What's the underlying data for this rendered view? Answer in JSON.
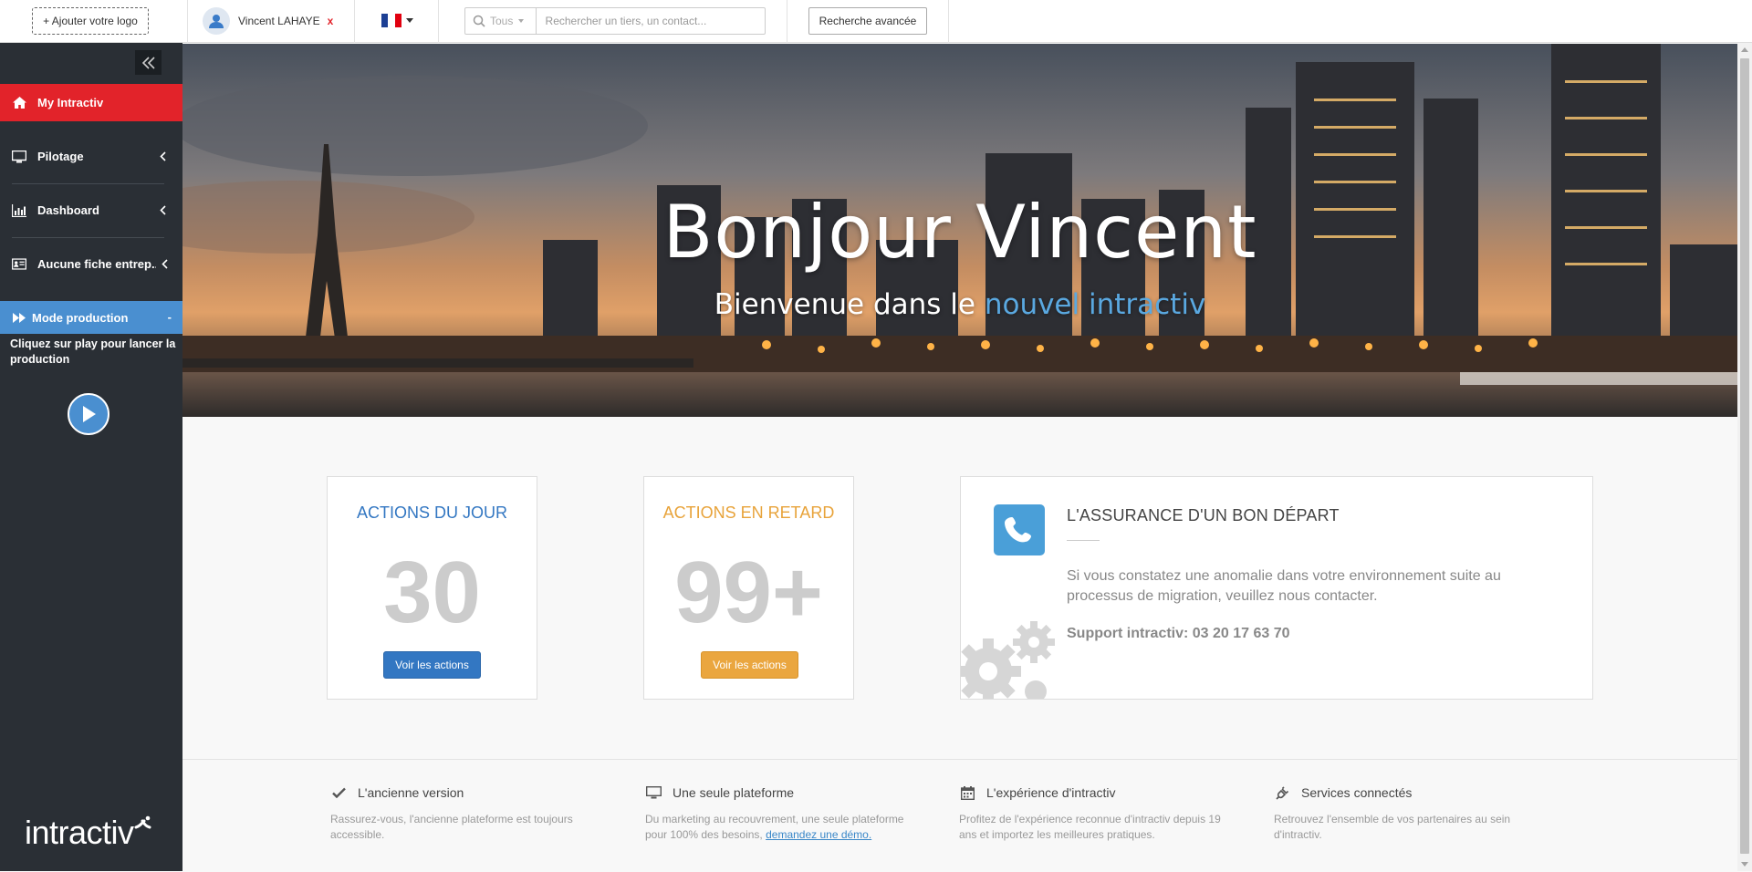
{
  "topbar": {
    "add_logo_label": "+ Ajouter votre logo",
    "user_name": "Vincent LAHAYE",
    "user_close": "x",
    "language_flag": "fr",
    "search_scope": "Tous",
    "search_placeholder": "Rechercher un tiers, un contact...",
    "advanced_search_label": "Recherche avancée"
  },
  "sidebar": {
    "items": [
      {
        "label": "My Intractiv",
        "icon": "home-icon",
        "active": true
      },
      {
        "label": "Pilotage",
        "icon": "monitor-icon"
      },
      {
        "label": "Dashboard",
        "icon": "bar-chart-icon"
      },
      {
        "label": "Aucune fiche entrep..",
        "icon": "id-card-icon"
      }
    ],
    "production": {
      "label": "Mode production",
      "toggle": "-",
      "description": "Cliquez sur play pour lancer la production"
    },
    "brand": "intractiv"
  },
  "hero": {
    "title": "Bonjour Vincent",
    "subtitle_prefix": "Bienvenue dans le",
    "subtitle_highlight": "nouvel intractiv"
  },
  "cards": {
    "today": {
      "title": "ACTIONS DU JOUR",
      "count": "30",
      "button": "Voir les actions"
    },
    "late": {
      "title": "ACTIONS EN RETARD",
      "count": "99+",
      "button": "Voir les actions"
    },
    "support": {
      "title": "L'ASSURANCE D'UN BON DÉPART",
      "text": "Si vous constatez une anomalie dans votre environnement suite au processus de migration, veuillez nous contacter.",
      "phone": "Support intractiv: 03 20 17 63 70"
    }
  },
  "colors": {
    "accent_red": "#e2232a",
    "accent_blue": "#4a8fd0",
    "today_blue": "#3377c2",
    "late_orange": "#e8a33a",
    "sidebar_bg": "#2a2f35"
  },
  "footer": {
    "features": [
      {
        "icon": "check-icon",
        "title": "L'ancienne version",
        "desc": "Rassurez-vous, l'ancienne plateforme est toujours accessible."
      },
      {
        "icon": "monitor-icon",
        "title": "Une seule plateforme",
        "desc": "Du marketing au recouvrement, une seule plateforme pour 100% des besoins,",
        "link": "demandez une démo."
      },
      {
        "icon": "calendar-icon",
        "title": "L'expérience d'intractiv",
        "desc": "Profitez de l'expérience reconnue d'intractiv depuis 19 ans et importez les meilleures pratiques."
      },
      {
        "icon": "plug-icon",
        "title": "Services connectés",
        "desc": "Retrouvez l'ensemble de vos partenaires au sein d'intractiv."
      }
    ]
  }
}
